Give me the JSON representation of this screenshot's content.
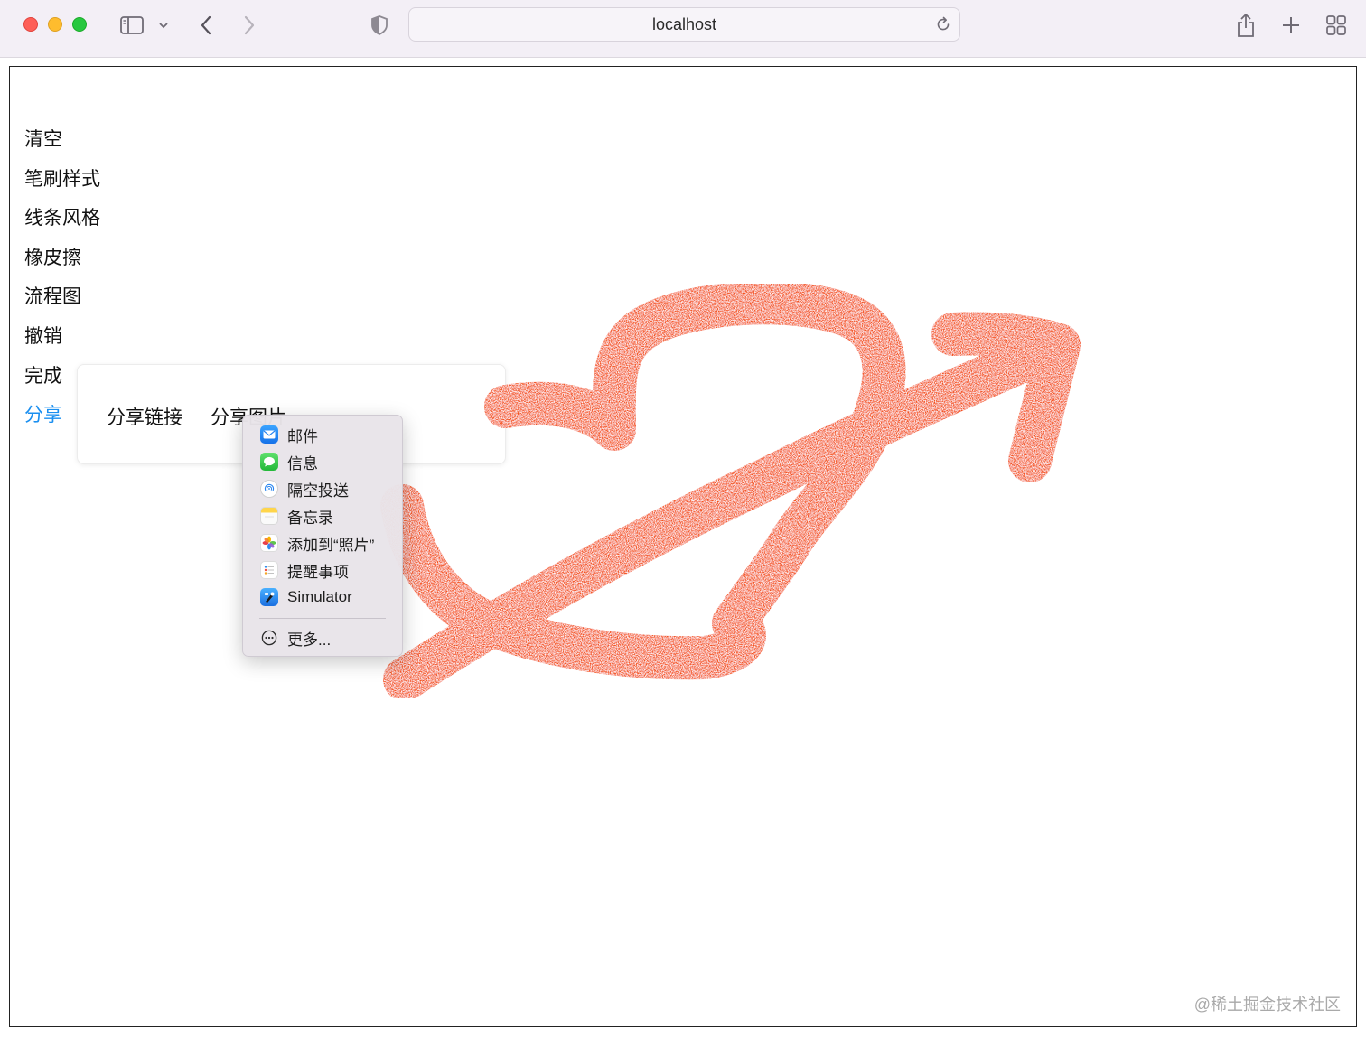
{
  "browser": {
    "address": "localhost",
    "icons": [
      "sidebar-icon",
      "chevron-down-icon",
      "back-icon",
      "forward-icon",
      "shield-icon",
      "reload-icon",
      "share-icon",
      "plus-icon",
      "tab-overview-icon"
    ]
  },
  "menu": {
    "items": [
      {
        "label": "清空"
      },
      {
        "label": "笔刷样式"
      },
      {
        "label": "线条风格"
      },
      {
        "label": "橡皮擦"
      },
      {
        "label": "流程图"
      },
      {
        "label": "撤销"
      },
      {
        "label": "完成"
      },
      {
        "label": "分享",
        "active": true
      }
    ]
  },
  "share_popover": {
    "link_label": "分享链接",
    "image_label": "分享图片"
  },
  "share_sheet": {
    "items": [
      {
        "label": "邮件",
        "icon": "mail-icon"
      },
      {
        "label": "信息",
        "icon": "messages-icon"
      },
      {
        "label": "隔空投送",
        "icon": "airdrop-icon"
      },
      {
        "label": "备忘录",
        "icon": "notes-icon"
      },
      {
        "label": "添加到“照片”",
        "icon": "photos-icon"
      },
      {
        "label": "提醒事项",
        "icon": "reminders-icon"
      },
      {
        "label": "Simulator",
        "icon": "simulator-icon"
      }
    ],
    "more_label": "更多..."
  },
  "drawing": {
    "stroke_color": "#f4541f"
  },
  "watermark": "@稀土掘金技术社区"
}
